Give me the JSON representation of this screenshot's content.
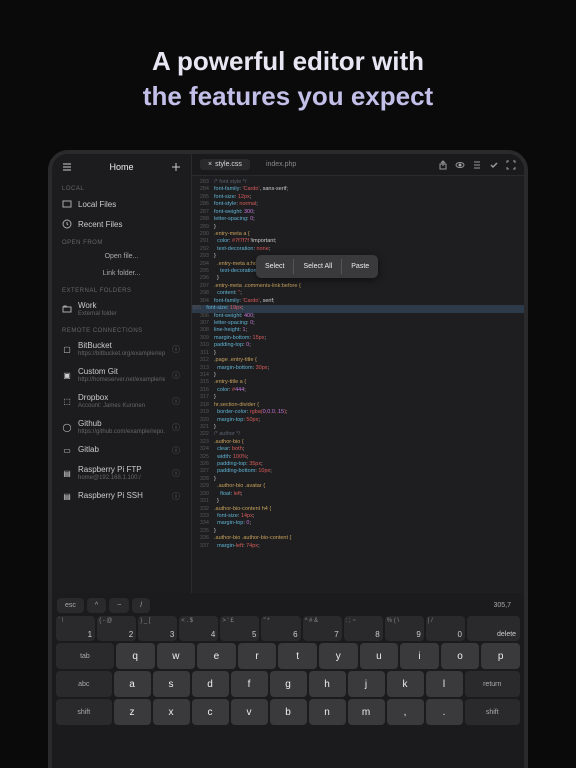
{
  "hero": {
    "line1": "A powerful editor with",
    "line2": "the features you expect"
  },
  "sidebar": {
    "title": "Home",
    "sec_local": "LOCAL",
    "local_files": "Local Files",
    "recent_files": "Recent Files",
    "sec_open": "OPEN FROM",
    "open_file": "Open file...",
    "link_folder": "Link folder...",
    "sec_ext": "EXTERNAL FOLDERS",
    "work": "Work",
    "work_sub": "External folder",
    "sec_remote": "REMOTE CONNECTIONS",
    "remotes": [
      {
        "name": "BitBucket",
        "sub": "https://bitbucket.org/example/repo.git"
      },
      {
        "name": "Custom Git",
        "sub": "http://homeserver.net/example/repo.git"
      },
      {
        "name": "Dropbox",
        "sub": "Account: James Kuronen"
      },
      {
        "name": "Github",
        "sub": "https://github.com/example/repo.git"
      },
      {
        "name": "Gitlab",
        "sub": ""
      },
      {
        "name": "Raspberry Pi FTP",
        "sub": "home@192.168.1.100:/"
      },
      {
        "name": "Raspberry Pi SSH",
        "sub": ""
      }
    ]
  },
  "tabs": {
    "t1": "style.css",
    "t2": "index.php"
  },
  "contextmenu": {
    "select": "Select",
    "select_all": "Select All",
    "paste": "Paste"
  },
  "code": [
    {
      "n": 283,
      "t": "/* font style */",
      "c": "cmt"
    },
    {
      "n": 284,
      "t": "font-family: 'Cardo', sans-serif;",
      "c": "p"
    },
    {
      "n": 285,
      "t": "font-size: 12px;",
      "c": "p"
    },
    {
      "n": 286,
      "t": "font-style: normal;",
      "c": "p"
    },
    {
      "n": 287,
      "t": "font-weight: 300;",
      "c": "p"
    },
    {
      "n": 288,
      "t": "letter-spacing: 0;",
      "c": "p"
    },
    {
      "n": 289,
      "t": "}",
      "c": ""
    },
    {
      "n": 290,
      "t": ".entry-meta a {",
      "c": "sel"
    },
    {
      "n": 291,
      "t": "  color: #7f7f7f !important;",
      "c": "p"
    },
    {
      "n": 292,
      "t": "  text-decoration: none;",
      "c": "p"
    },
    {
      "n": 293,
      "t": "}",
      "c": ""
    },
    {
      "n": 294,
      "t": "  .entry-meta a:hover {",
      "c": "sel"
    },
    {
      "n": 295,
      "t": "    text-decoration: underline;",
      "c": "p"
    },
    {
      "n": 296,
      "t": "  }",
      "c": ""
    },
    {
      "n": 297,
      "t": ".entry-meta .comments-link:before {",
      "c": "sel"
    },
    {
      "n": 298,
      "t": "  content: '';",
      "c": "p"
    },
    {
      "n": 304,
      "t": "font-family: 'Cardo', serif;",
      "c": "p"
    },
    {
      "n": 305,
      "t": "font-size: 19px;",
      "c": "p",
      "hl": true
    },
    {
      "n": 306,
      "t": "font-weight: 400;",
      "c": "p"
    },
    {
      "n": 307,
      "t": "letter-spacing: 0;",
      "c": "p"
    },
    {
      "n": 308,
      "t": "line-height: 1;",
      "c": "p"
    },
    {
      "n": 309,
      "t": "margin-bottom: 15px;",
      "c": "p"
    },
    {
      "n": 310,
      "t": "padding-top: 0;",
      "c": "p"
    },
    {
      "n": 311,
      "t": "}",
      "c": ""
    },
    {
      "n": 312,
      "t": ".page .entry-title {",
      "c": "sel"
    },
    {
      "n": 313,
      "t": "  margin-bottom: 30px;",
      "c": "p"
    },
    {
      "n": 314,
      "t": "}",
      "c": ""
    },
    {
      "n": 315,
      "t": ".entry-title a {",
      "c": "sel"
    },
    {
      "n": 316,
      "t": "  color: #444;",
      "c": "p"
    },
    {
      "n": 317,
      "t": "}",
      "c": ""
    },
    {
      "n": 318,
      "t": "hr.section-divider {",
      "c": "sel"
    },
    {
      "n": 319,
      "t": "  border-color: rgba(0,0,0,.15);",
      "c": "p"
    },
    {
      "n": 320,
      "t": "  margin-top: 50px;",
      "c": "p"
    },
    {
      "n": 321,
      "t": "}",
      "c": ""
    },
    {
      "n": 322,
      "t": "/* author */",
      "c": "cmt"
    },
    {
      "n": 323,
      "t": ".author-bio {",
      "c": "sel"
    },
    {
      "n": 324,
      "t": "  clear: both;",
      "c": "p"
    },
    {
      "n": 325,
      "t": "  width: 100%;",
      "c": "p"
    },
    {
      "n": 326,
      "t": "  padding-top: 35px;",
      "c": "p"
    },
    {
      "n": 327,
      "t": "  padding-bottom: 10px;",
      "c": "p"
    },
    {
      "n": 328,
      "t": "}",
      "c": ""
    },
    {
      "n": 329,
      "t": "  .author-bio .avatar {",
      "c": "sel"
    },
    {
      "n": 330,
      "t": "    float: left;",
      "c": "p"
    },
    {
      "n": 331,
      "t": "  }",
      "c": ""
    },
    {
      "n": 332,
      "t": ".author-bio-content h4 {",
      "c": "sel"
    },
    {
      "n": 333,
      "t": "  font-size: 14px;",
      "c": "p"
    },
    {
      "n": 334,
      "t": "  margin-top: 0;",
      "c": "p"
    },
    {
      "n": 335,
      "t": "}",
      "c": ""
    },
    {
      "n": 336,
      "t": ".author-bio .author-bio-content {",
      "c": "sel"
    },
    {
      "n": 337,
      "t": "  margin-left: 74px;",
      "c": "p"
    }
  ],
  "kb": {
    "esc": "esc",
    "caret": "^",
    "tilde": "~",
    "slash": "/",
    "cursor": "305,7",
    "numrow": [
      {
        "s": "` !",
        "n": "1"
      },
      {
        "s": "{ - @",
        "n": "2"
      },
      {
        "s": "} _ [",
        "n": "3"
      },
      {
        "s": "< . $",
        "n": "4"
      },
      {
        "s": "> ' £",
        "n": "5"
      },
      {
        "s": "\" *",
        "n": "6"
      },
      {
        "s": "^ # &",
        "n": "7"
      },
      {
        "s": ": ; ~",
        "n": "8"
      },
      {
        "s": "% ( \\",
        "n": "9"
      },
      {
        "s": "| /",
        "n": "0"
      },
      {
        "s": "delete",
        "n": "",
        "wide": true
      }
    ],
    "r1": [
      "tab",
      "q",
      "w",
      "e",
      "r",
      "t",
      "y",
      "u",
      "i",
      "o",
      "p"
    ],
    "r2": [
      "abc",
      "a",
      "s",
      "d",
      "f",
      "g",
      "h",
      "j",
      "k",
      "l",
      "return"
    ],
    "r3": [
      "shift",
      "z",
      "x",
      "c",
      "v",
      "b",
      "n",
      "m",
      ",",
      ".",
      "shift"
    ]
  }
}
